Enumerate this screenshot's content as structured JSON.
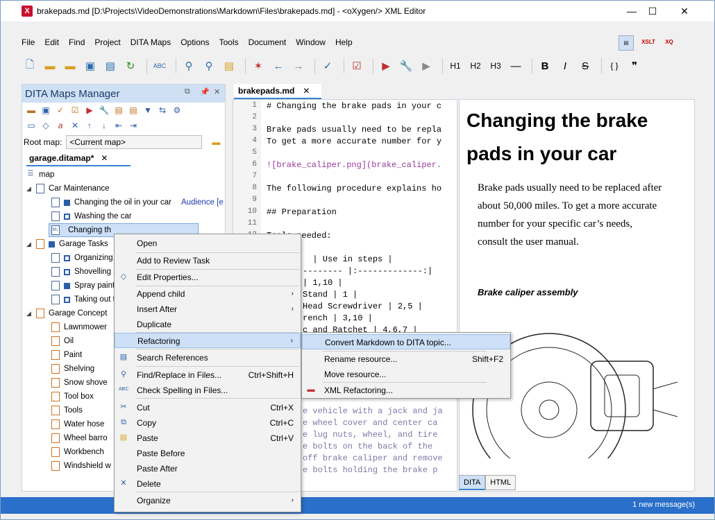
{
  "window": {
    "title": "brakepads.md [D:\\Projects\\VideoDemonstrations\\Markdown\\Files\\brakepads.md] - <oXygen/> XML Editor",
    "minimize": "—",
    "maximize": "☐",
    "close": "✕"
  },
  "menu": [
    "File",
    "Edit",
    "Find",
    "Project",
    "DITA Maps",
    "Options",
    "Tools",
    "Document",
    "Window",
    "Help"
  ],
  "toolbar": {
    "h1": "H1",
    "h2": "H2",
    "h3": "H3",
    "hr": "—",
    "bold": "B",
    "italic": "I",
    "strike": "S",
    "braces": "{ }",
    "quote": "❞",
    "xslt": "XSLT",
    "xq": "XQ"
  },
  "maps_panel": {
    "title": "DITA Maps Manager",
    "root_map_label": "Root map:",
    "root_map_value": "<Current map>",
    "tab": "garage.ditamap*",
    "tree": [
      {
        "label": "map",
        "indent": 0
      },
      {
        "label": "Car Maintenance",
        "indent": 1
      },
      {
        "label": "Changing the oil in your car",
        "extra": "Audience [e",
        "indent": 2
      },
      {
        "label": "Washing the car",
        "indent": 2
      },
      {
        "label": "Changing th",
        "indent": 2,
        "selected": true
      },
      {
        "label": "Garage Tasks",
        "indent": 1
      },
      {
        "label": "Organizing t",
        "indent": 2
      },
      {
        "label": "Shovelling s",
        "indent": 2
      },
      {
        "label": "Spray painti",
        "indent": 2
      },
      {
        "label": "Taking out t",
        "indent": 2
      },
      {
        "label": "Garage Concept",
        "indent": 1
      },
      {
        "label": "Lawnmower",
        "indent": 2
      },
      {
        "label": "Oil",
        "indent": 2
      },
      {
        "label": "Paint",
        "indent": 2
      },
      {
        "label": "Shelving",
        "indent": 2
      },
      {
        "label": "Snow shove",
        "indent": 2
      },
      {
        "label": "Tool box",
        "indent": 2
      },
      {
        "label": "Tools",
        "indent": 2
      },
      {
        "label": "Water hose",
        "indent": 2
      },
      {
        "label": "Wheel barro",
        "indent": 2
      },
      {
        "label": "Workbench",
        "indent": 2
      },
      {
        "label": "Windshield w",
        "indent": 2
      }
    ]
  },
  "editor": {
    "tab": "brakepads.md",
    "lines": [
      "1",
      "2",
      "3",
      "4",
      "5",
      "6",
      "7",
      "8",
      "9",
      "10",
      "11",
      "12"
    ],
    "code": [
      "# Changing the brake pads in your c",
      "",
      "Brake pads usually need to be repla",
      "To get a more accurate number for y",
      "",
      "![brake_caliper.png](brake_caliper.",
      "",
      "The following procedure explains ho",
      "",
      "## Preparation",
      "",
      "Tools needed:"
    ],
    "code_tail": [
      "  | Use in steps |",
      "-------- |:-------------:|",
      "| 1,10 |",
      "Stand | 1 |",
      "Head Screwdriver | 2,5 |",
      "rench | 3,10 |",
      "c and Ratchet | 4,6,7 |"
    ],
    "code_tail2": [
      "e vehicle with a jack and ja",
      "e wheel cover and center ca",
      "e lug nuts, wheel, and tire",
      "e bolts on the back of the",
      "off brake caliper and remove",
      "e bolts holding the brake p"
    ]
  },
  "preview": {
    "title": "Changing the brake pads in your car",
    "paragraph": "Brake pads usually need to be replaced after about 50,000 miles. To get a more accurate number for your specific car’s needs, consult the user manual.",
    "caption": "Brake caliper assembly",
    "tab_dita": "DITA",
    "tab_html": "HTML"
  },
  "context_menu": [
    {
      "label": "Open"
    },
    {
      "label": "Add to Review Task"
    },
    {
      "label": "Edit Properties..."
    },
    {
      "label": "Append child",
      "arrow": "›"
    },
    {
      "label": "Insert After",
      "arrow": "›"
    },
    {
      "label": "Duplicate"
    },
    {
      "label": "Refactoring",
      "arrow": "›",
      "highlight": true
    },
    {
      "label": "Search References"
    },
    {
      "label": "Find/Replace in Files...",
      "shortcut": "Ctrl+Shift+H"
    },
    {
      "label": "Check Spelling in Files..."
    },
    {
      "label": "Cut",
      "shortcut": "Ctrl+X"
    },
    {
      "label": "Copy",
      "shortcut": "Ctrl+C"
    },
    {
      "label": "Paste",
      "shortcut": "Ctrl+V"
    },
    {
      "label": "Paste Before"
    },
    {
      "label": "Paste After"
    },
    {
      "label": "Delete"
    },
    {
      "label": "Organize",
      "arrow": "›"
    }
  ],
  "submenu": [
    {
      "label": "Convert Markdown to DITA topic...",
      "highlight": true
    },
    {
      "label": "Rename resource...",
      "shortcut": "Shift+F2"
    },
    {
      "label": "Move resource..."
    },
    {
      "label": "XML Refactoring..."
    }
  ],
  "status": {
    "messages": "1 new message(s)"
  }
}
